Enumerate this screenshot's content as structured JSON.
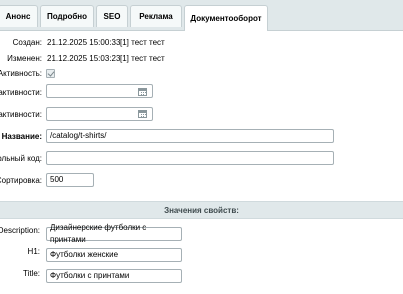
{
  "tabs": [
    {
      "label": "Анонс",
      "active": false
    },
    {
      "label": "Подробно",
      "active": false
    },
    {
      "label": "SEO",
      "active": false
    },
    {
      "label": "Реклама",
      "active": false
    },
    {
      "label": "Документооборот",
      "active": true
    }
  ],
  "fields": {
    "created_label": "Создан:",
    "created_value": "21.12.2025 15:00:33",
    "created_user": "[1] тест тест",
    "modified_label": "Изменен:",
    "modified_value": "21.12.2025 15:03:23",
    "modified_user": "[1] тест тест",
    "active_label": "Активность:",
    "active_checked": true,
    "active_from_label": "активности:",
    "active_from_value": "",
    "active_to_label": "активности:",
    "active_to_value": "",
    "name_label": "Название:",
    "name_value": "/catalog/t-shirts/",
    "code_label": "вольный код:",
    "code_value": "",
    "sort_label": "Сортировка:",
    "sort_value": "500"
  },
  "section_title": "Значения свойств:",
  "properties": [
    {
      "label": "Description:",
      "value": "Дизайнерские футболки с принтами"
    },
    {
      "label": "H1:",
      "value": "Футболки женские"
    },
    {
      "label": "Title:",
      "value": "Футболки с принтами"
    }
  ],
  "colors": {
    "tabbar_bg": "#e0e8ea",
    "section_bg": "#e0e8ea",
    "input_border": "#a6b0b5"
  }
}
